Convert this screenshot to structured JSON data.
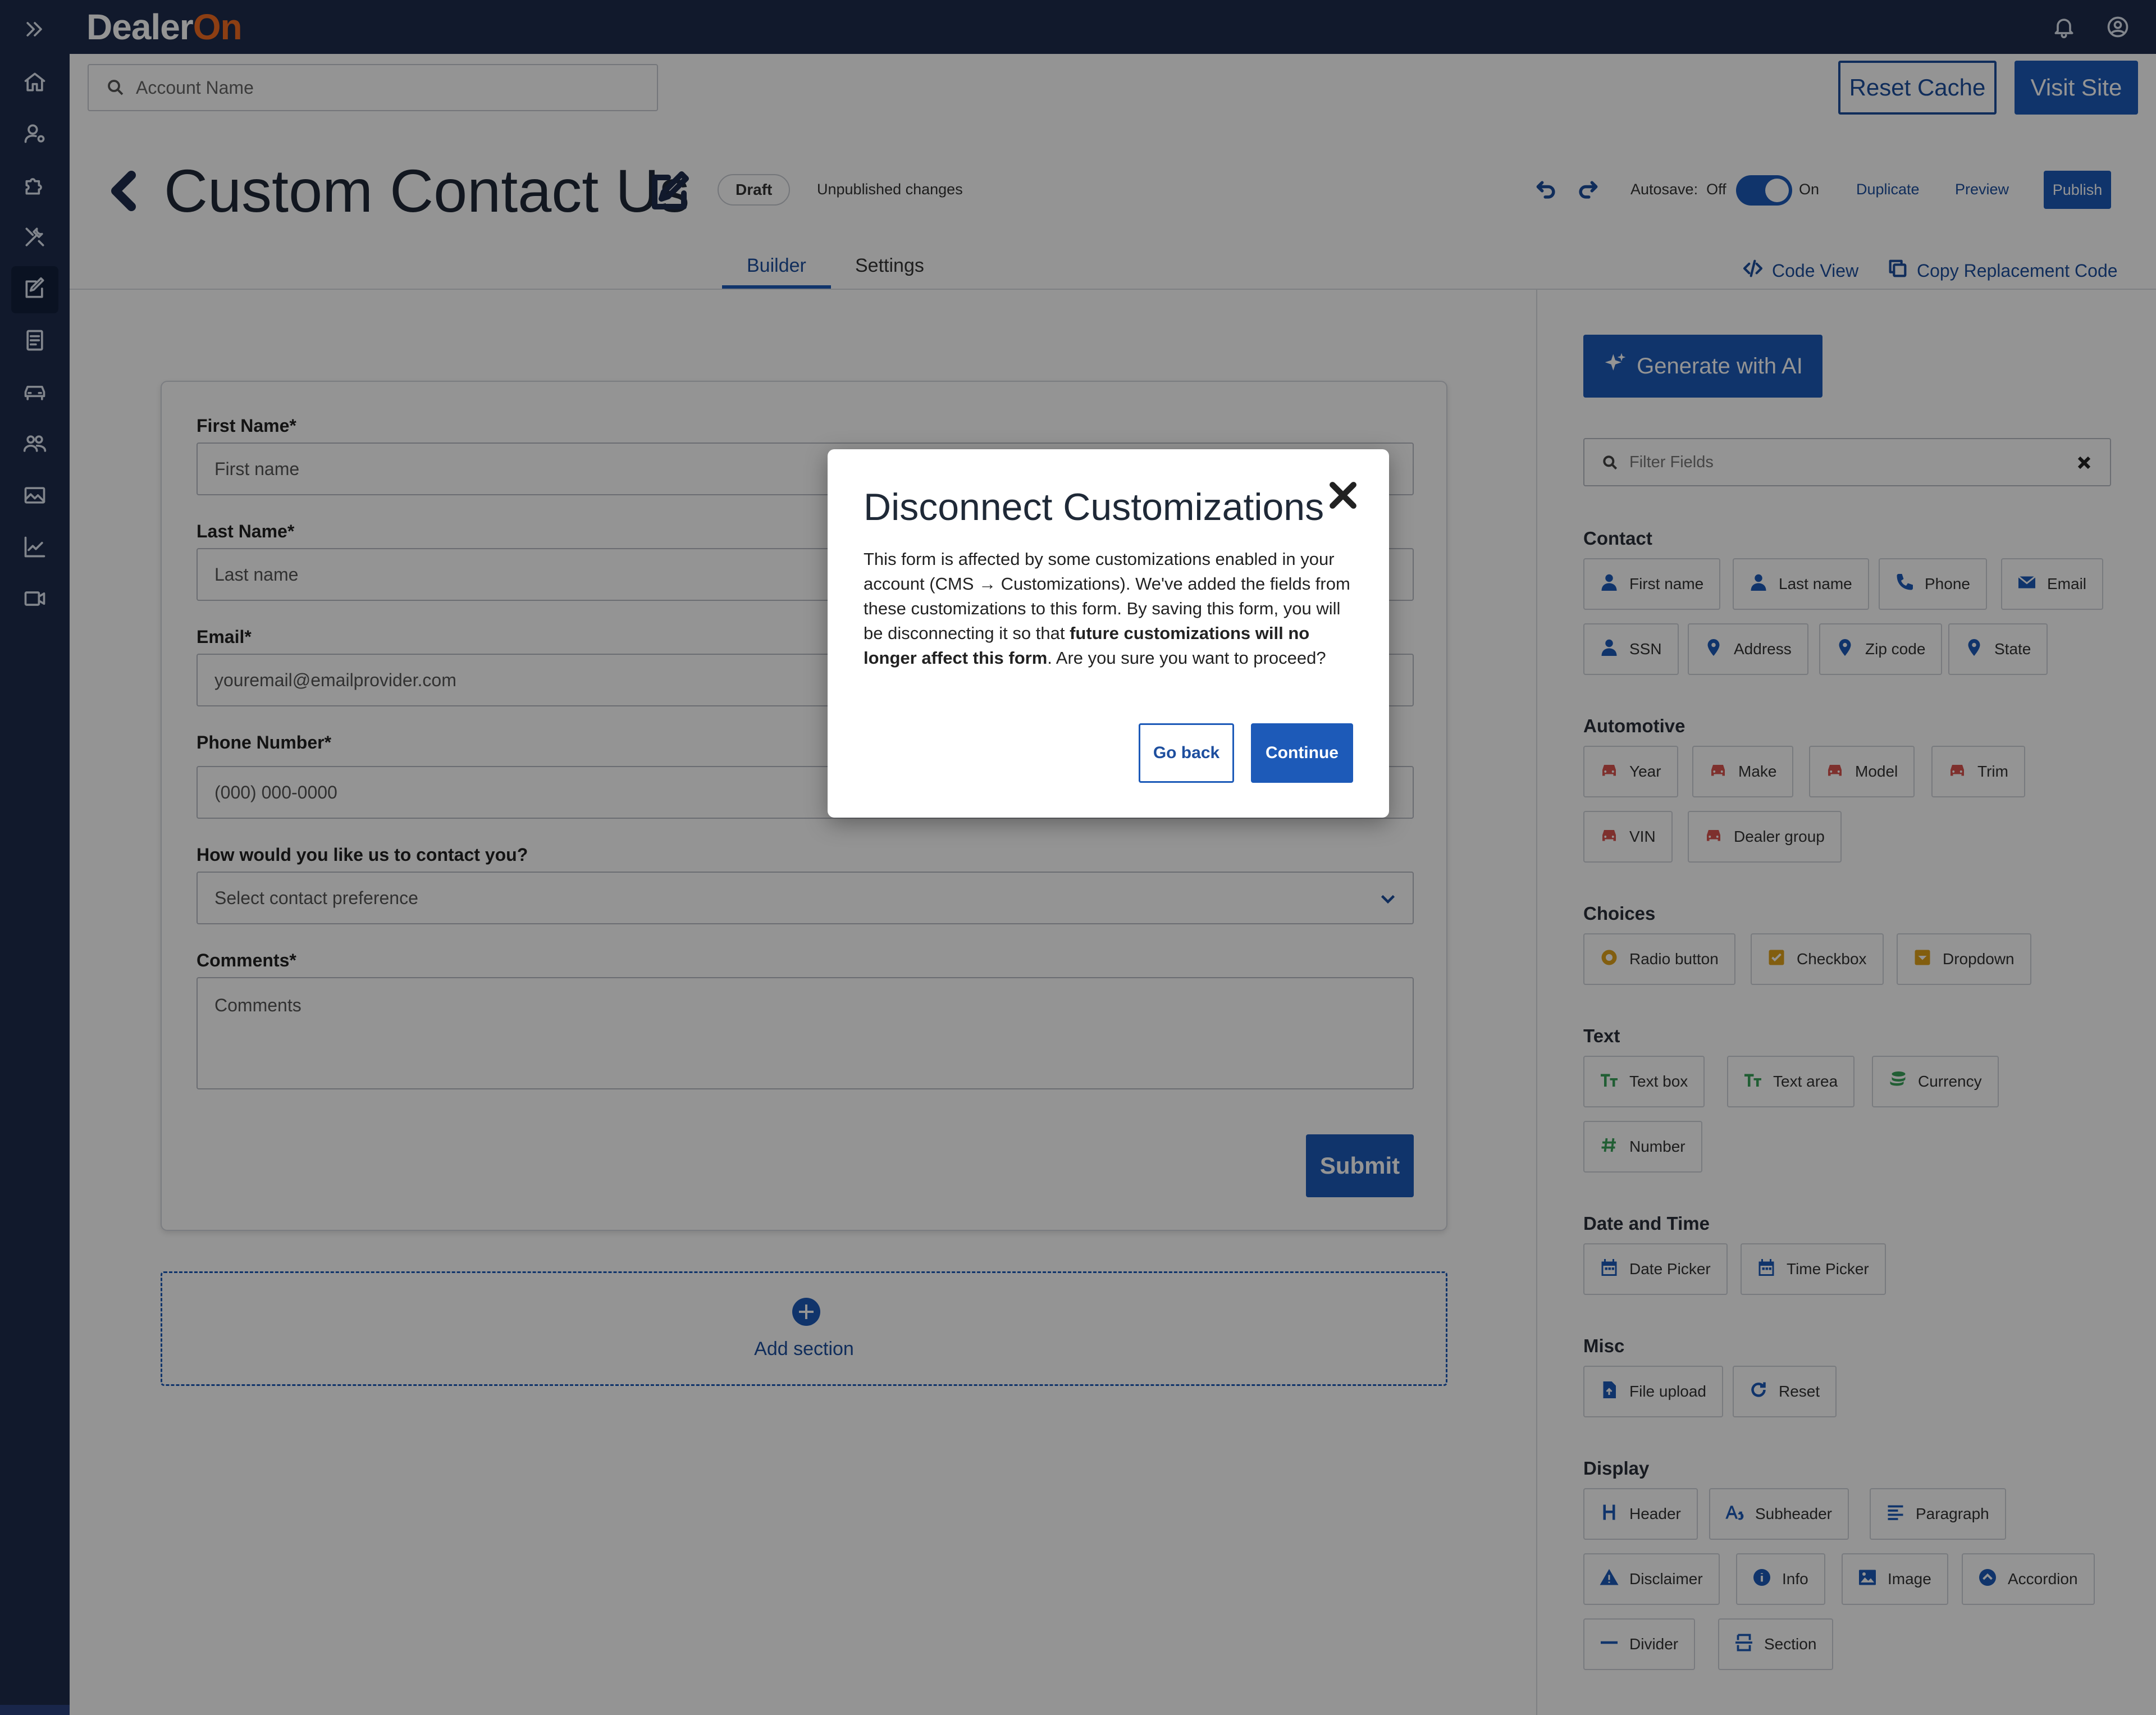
{
  "app": {
    "logo_prefix": "Dealer",
    "logo_suffix": "On",
    "brand_color": "#f26b21"
  },
  "nav": {
    "expand_icon": "double-chevron-right-icon",
    "items": [
      {
        "name": "home",
        "icon": "home-icon"
      },
      {
        "name": "users",
        "icon": "user-gear-icon"
      },
      {
        "name": "plugins",
        "icon": "puzzle-icon"
      },
      {
        "name": "tools",
        "icon": "tools-icon"
      },
      {
        "name": "forms",
        "icon": "edit-icon",
        "active": true
      },
      {
        "name": "documents",
        "icon": "document-icon"
      },
      {
        "name": "inventory",
        "icon": "car-icon"
      },
      {
        "name": "leads",
        "icon": "people-icon"
      },
      {
        "name": "media",
        "icon": "image-icon"
      },
      {
        "name": "analytics",
        "icon": "chart-icon"
      },
      {
        "name": "video",
        "icon": "video-icon"
      }
    ]
  },
  "header": {
    "search_placeholder": "Account Name",
    "reset_cache": "Reset Cache",
    "visit_site": "Visit Site"
  },
  "page": {
    "title": "Custom Contact Us",
    "status": "Draft",
    "unpublished": "Unpublished changes",
    "autosave_label": "Autosave:",
    "autosave_off": "Off",
    "autosave_on": "On",
    "autosave_enabled": true,
    "duplicate": "Duplicate",
    "preview": "Preview",
    "publish": "Publish",
    "tabs": [
      "Builder",
      "Settings"
    ],
    "active_tab": "Builder",
    "code_view": "Code View",
    "copy_code": "Copy Replacement Code"
  },
  "form": {
    "fields": [
      {
        "label": "First Name*",
        "placeholder": "First name"
      },
      {
        "label": "Last Name*",
        "placeholder": "Last name"
      },
      {
        "label": "Email*",
        "placeholder": "youremail@emailprovider.com"
      },
      {
        "label": "Phone Number*",
        "placeholder": "(000) 000-0000"
      },
      {
        "label": "How would you like us to contact you?",
        "placeholder": "Select contact preference"
      },
      {
        "label": "Comments*",
        "placeholder": "Comments"
      }
    ],
    "submit": "Submit",
    "add_section": "Add section"
  },
  "panel": {
    "generate_ai": "Generate with AI",
    "filter_placeholder": "Filter Fields",
    "groups": [
      {
        "title": "Contact",
        "chips": [
          "First name",
          "Last name",
          "Phone",
          "Email",
          "SSN",
          "Address",
          "Zip code",
          "State"
        ]
      },
      {
        "title": "Automotive",
        "chips": [
          "Year",
          "Make",
          "Model",
          "Trim",
          "VIN",
          "Dealer group"
        ]
      },
      {
        "title": "Choices",
        "chips": [
          "Radio button",
          "Checkbox",
          "Dropdown"
        ]
      },
      {
        "title": "Text",
        "chips": [
          "Text box",
          "Text area",
          "Currency",
          "Number"
        ]
      },
      {
        "title": "Date and Time",
        "chips": [
          "Date Picker",
          "Time Picker"
        ]
      },
      {
        "title": "Misc",
        "chips": [
          "File upload",
          "Reset"
        ]
      },
      {
        "title": "Display",
        "chips": [
          "Header",
          "Subheader",
          "Paragraph",
          "Disclaimer",
          "Info",
          "Image",
          "Accordion",
          "Divider",
          "Section"
        ]
      }
    ],
    "icon_colors": {
      "contact": "#1d5ab8",
      "automotive": "#d9534f",
      "choices": "#e0a21a",
      "text": "#3aa35a",
      "datetime": "#1d5ab8",
      "misc": "#1d5ab8",
      "display": "#1d5ab8"
    }
  },
  "modal": {
    "title": "Disconnect Customizations",
    "body_1": "This form is affected by some customizations enabled in your account (CMS → Customizations). We've added the fields from these customizations to this form. By saving this form, you will be disconnecting it so that ",
    "body_bold": "future customizations will no longer affect this form",
    "body_2": ". Are you sure you want to proceed?",
    "go_back": "Go back",
    "continue": "Continue"
  }
}
